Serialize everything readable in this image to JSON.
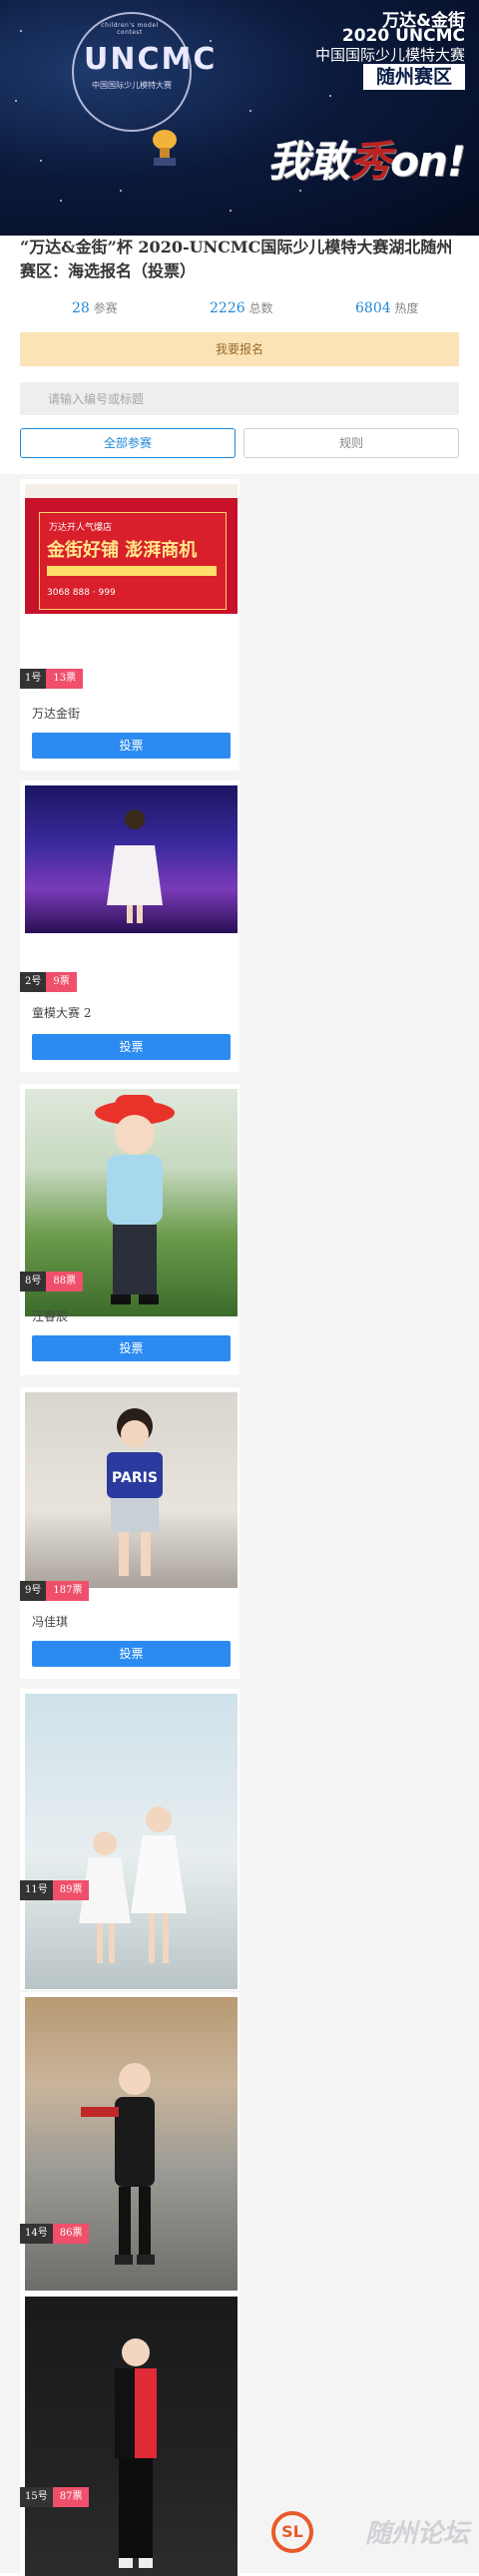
{
  "banner": {
    "logo_small": "children's model contest",
    "logo_text": "UNCMC",
    "logo_sub": "中国国际少儿模特大赛",
    "title1": "万达&金街",
    "title2": "2020 UNCMC",
    "title3": "中国国际少儿模特大赛",
    "region": "随州赛区",
    "slogan_a": "我敢",
    "slogan_b": "秀",
    "slogan_c": "on!"
  },
  "page_title": "“万达&金街”杯 2020-UNCMC国际少儿模特大赛湖北随州赛区：海选报名（投票）",
  "stats": [
    {
      "num": "28",
      "label": "参赛"
    },
    {
      "num": "2226",
      "label": "总数"
    },
    {
      "num": "6804",
      "label": "热度"
    }
  ],
  "signup_label": "我要报名",
  "search": {
    "placeholder": "请输入编号或标题"
  },
  "tabs": {
    "all": "全部参赛",
    "rules": "规则"
  },
  "vote_label": "投票",
  "ad": {
    "line1": "万达开人气爆店",
    "line2": "金街好铺 澎湃商机",
    "line3": "3068 888 · 999"
  },
  "contestants": [
    {
      "no": "1号",
      "votes": "13票",
      "name": "万达金街"
    },
    {
      "no": "2号",
      "votes": "9票",
      "name": "童模大赛 2"
    },
    {
      "no": "8号",
      "votes": "88票",
      "name": "汪睿辰"
    },
    {
      "no": "9号",
      "votes": "187票",
      "name": "冯佳琪"
    },
    {
      "no": "11号",
      "votes": "89票",
      "name": ""
    },
    {
      "no": "14号",
      "votes": "86票",
      "name": ""
    },
    {
      "no": "15号",
      "votes": "87票",
      "name": ""
    }
  ],
  "watermark": {
    "logo": "SL",
    "text": "随州论坛"
  }
}
